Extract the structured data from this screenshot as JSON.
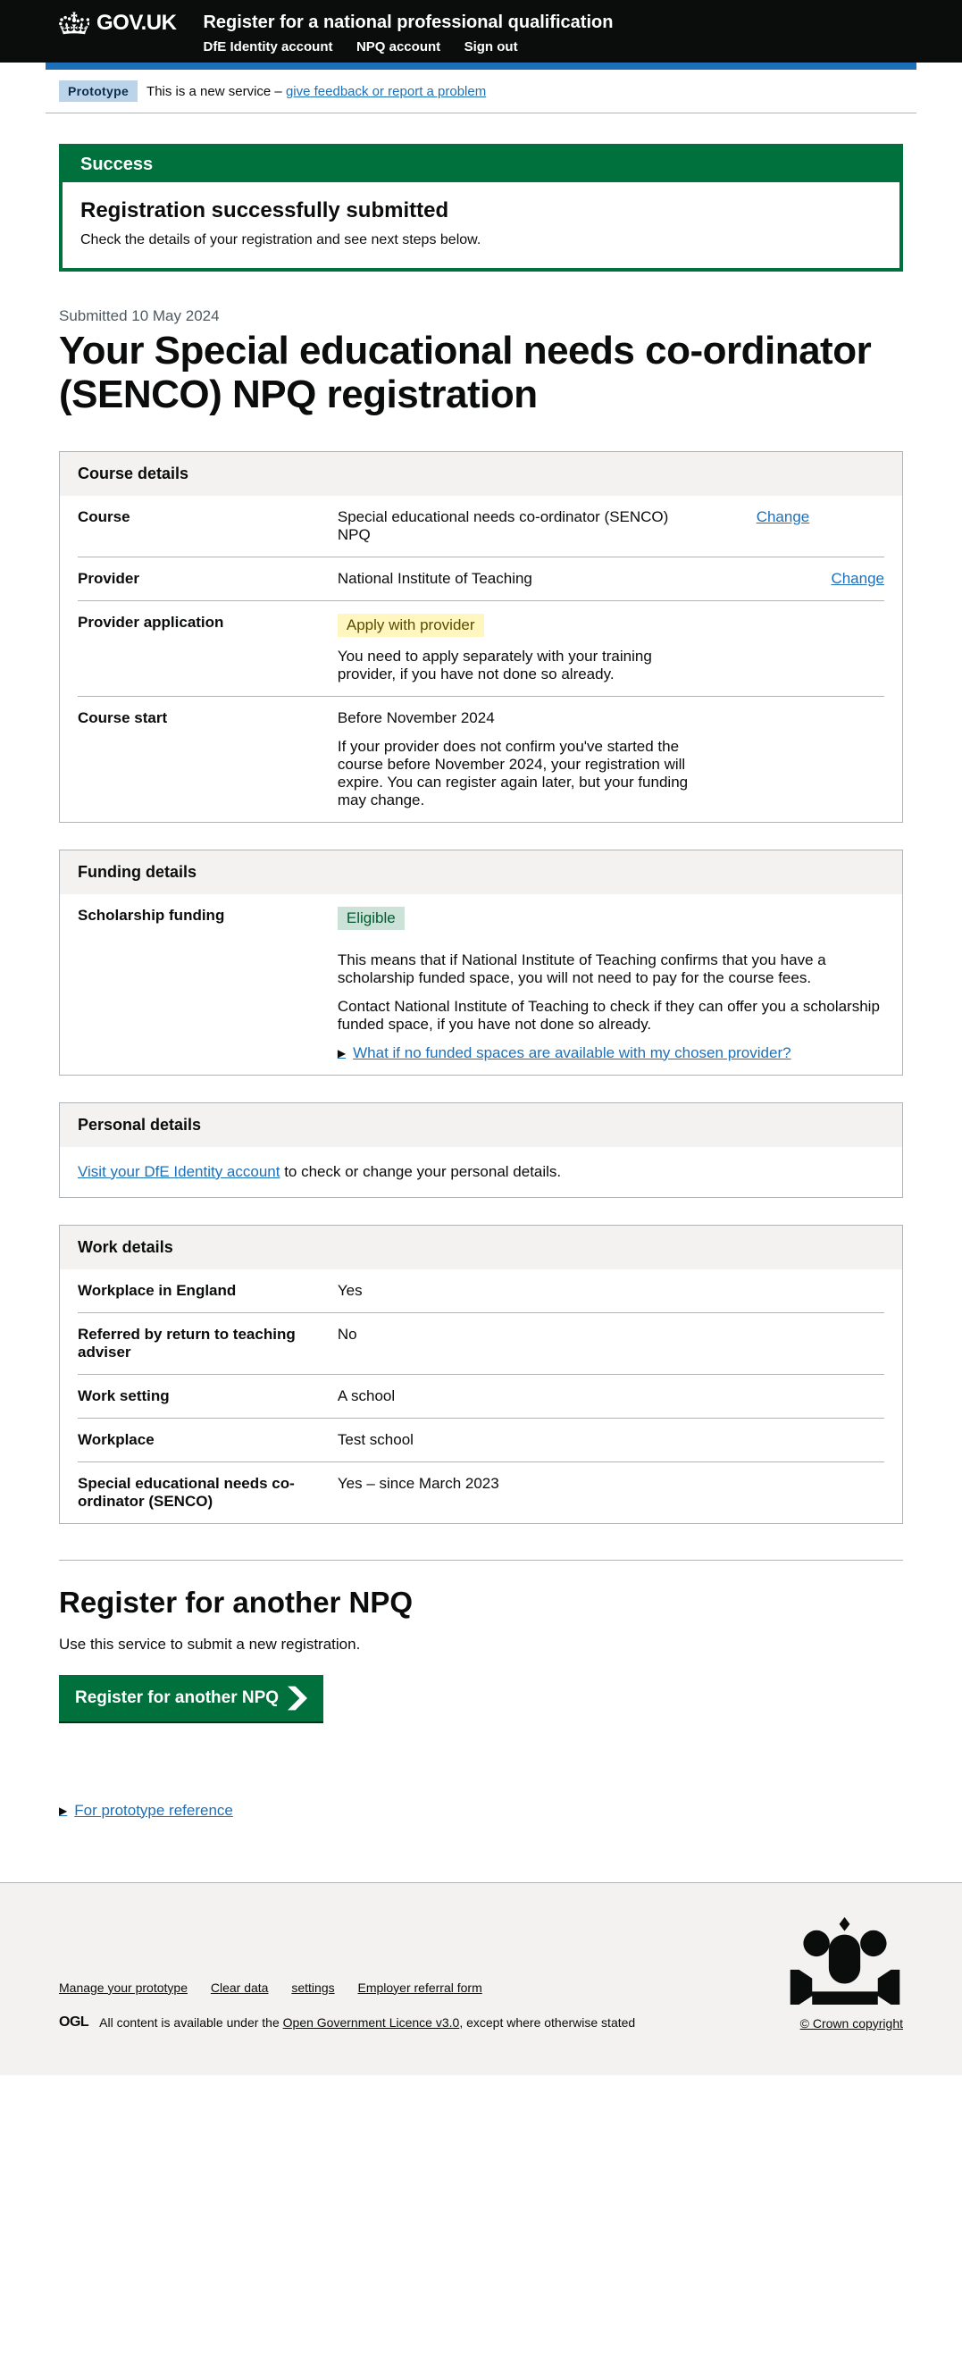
{
  "header": {
    "logotype": "GOV.UK",
    "service_name": "Register for a national professional qualification",
    "nav": [
      {
        "label": "DfE Identity account"
      },
      {
        "label": "NPQ account"
      },
      {
        "label": "Sign out"
      }
    ]
  },
  "phase": {
    "tag": "Prototype",
    "text_a": "This is a new service – ",
    "link": "give feedback or report a problem"
  },
  "success": {
    "tag": "Success",
    "heading": "Registration successfully submitted",
    "body": "Check the details of your registration and see next steps below."
  },
  "submitted": "Submitted 10 May 2024",
  "page_title": "Your Special educational needs co-ordinator (SENCO) NPQ registration",
  "cards": {
    "course": {
      "title": "Course details",
      "rows": [
        {
          "key": "Course",
          "value": "Special educational needs co-ordinator (SENCO) NPQ",
          "action": "Change"
        },
        {
          "key": "Provider",
          "value": "National Institute of Teaching",
          "action": "Change"
        },
        {
          "key": "Provider application",
          "tag": "Apply with provider",
          "value": "You need to apply separately with your training provider, if you have not done so already."
        },
        {
          "key": "Course start",
          "value_a": "Before November 2024",
          "value_b": "If your provider does not confirm you've started the course before November 2024, your registration will expire. You can register again later, but your funding may change."
        }
      ]
    },
    "funding": {
      "title": "Funding details",
      "row": {
        "key": "Scholarship funding",
        "tag": "Eligible",
        "p1": "This means that if National Institute of Teaching confirms that you have a scholarship funded space, you will not need to pay for the course fees.",
        "p2": "Contact National Institute of Teaching to check if they can offer you a scholarship funded space, if you have not done so already.",
        "details": "What if no funded spaces are available with my chosen provider?"
      }
    },
    "personal": {
      "title": "Personal details",
      "link": "Visit your DfE Identity account",
      "after": " to check or change your personal details."
    },
    "work": {
      "title": "Work details",
      "rows": [
        {
          "key": "Workplace in England",
          "value": "Yes"
        },
        {
          "key": "Referred by return to teaching adviser",
          "value": "No"
        },
        {
          "key": "Work setting",
          "value": "A school"
        },
        {
          "key": "Workplace",
          "value": "Test school"
        },
        {
          "key": "Special educational needs co-ordinator (SENCO)",
          "value": "Yes – since March 2023"
        }
      ]
    }
  },
  "register_another": {
    "heading": "Register for another NPQ",
    "body": "Use this service to submit a new registration.",
    "button": "Register for another NPQ"
  },
  "prototype_details": "For prototype reference",
  "footer": {
    "links": [
      {
        "label": "Manage your prototype"
      },
      {
        "label": "Clear data"
      },
      {
        "label": "settings"
      },
      {
        "label": "Employer referral form"
      }
    ],
    "ogl": "OGL",
    "licence_a": "All content is available under the ",
    "licence_link": "Open Government Licence v3.0",
    "licence_b": ", except where otherwise stated",
    "copyright": "© Crown copyright"
  }
}
